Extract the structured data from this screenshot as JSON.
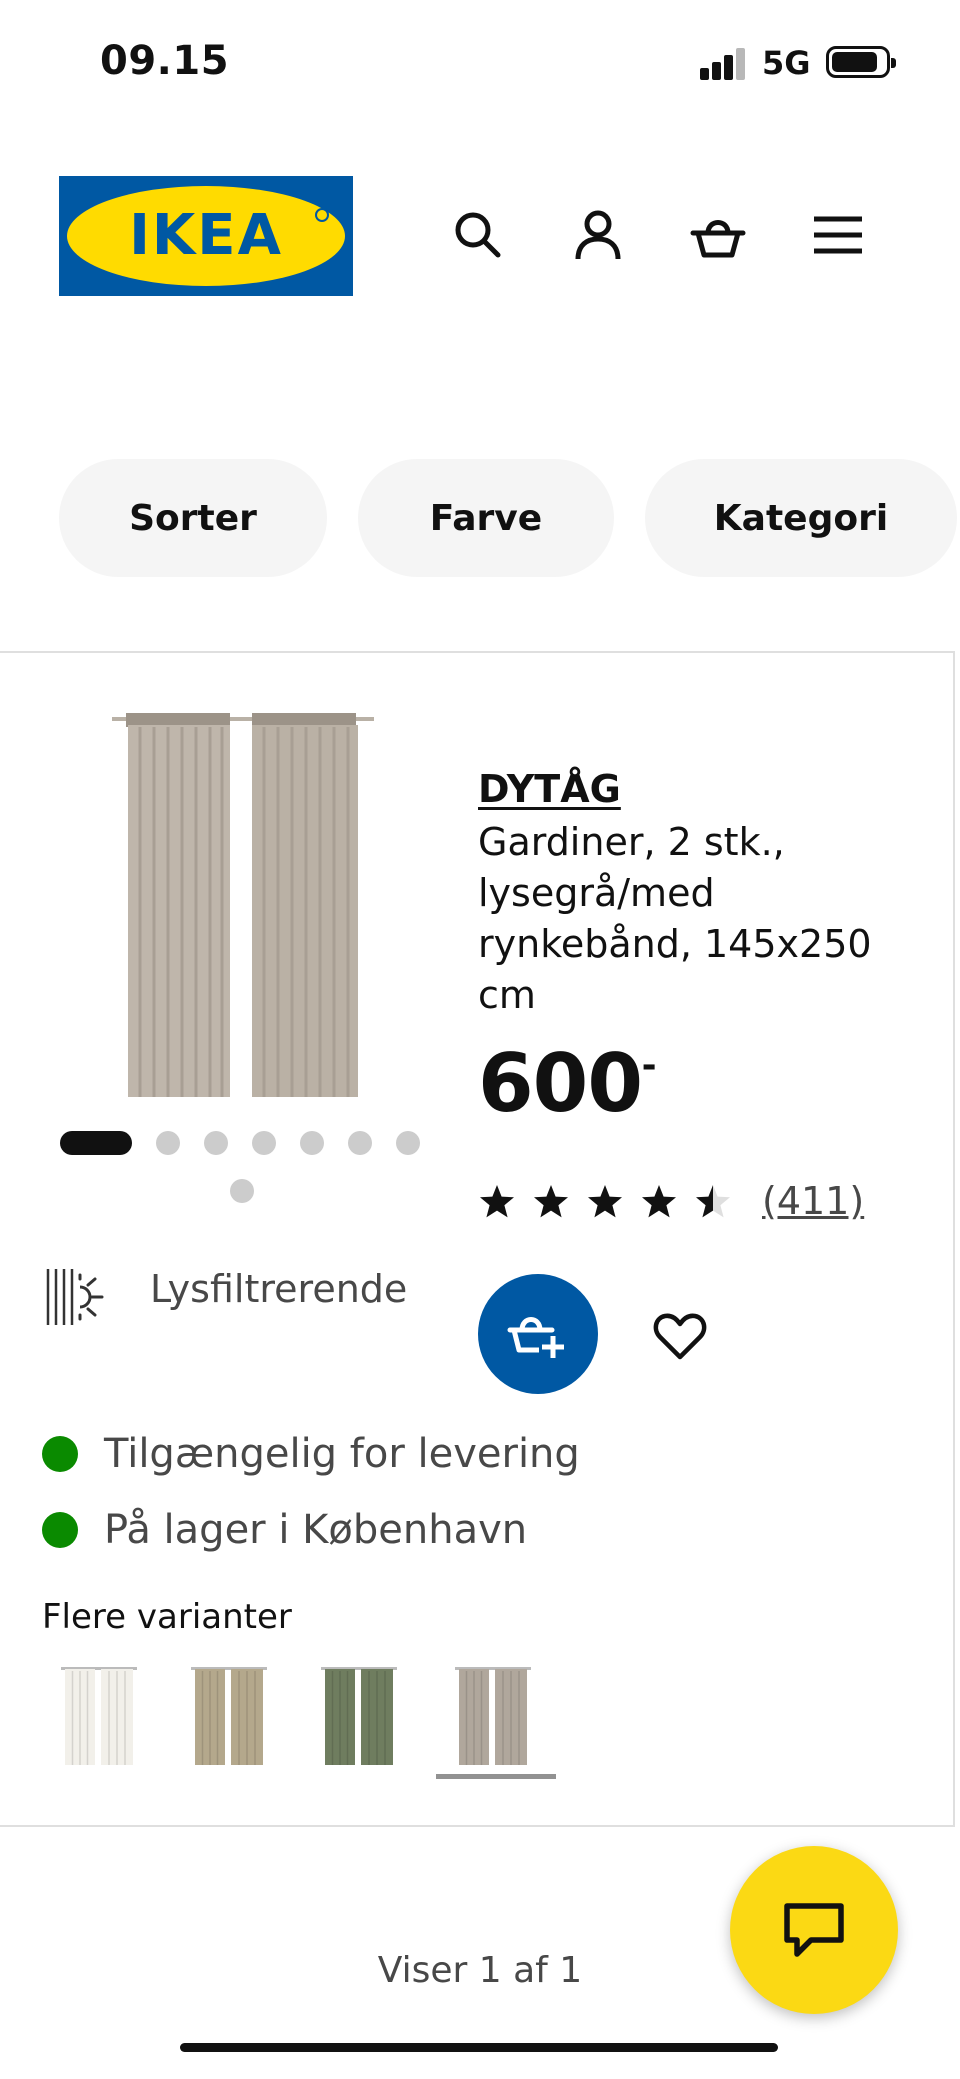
{
  "status_bar": {
    "time": "09.15",
    "network": "5G",
    "icons": [
      "signal-icon",
      "battery-icon"
    ]
  },
  "header": {
    "logo_text": "IKEA",
    "brand_colors": {
      "blue": "#0058a3",
      "yellow": "#ffdb00"
    },
    "icons": [
      "search-icon",
      "account-icon",
      "cart-icon",
      "menu-icon"
    ]
  },
  "filters": [
    {
      "label": "Sorter"
    },
    {
      "label": "Farve"
    },
    {
      "label": "Kategori"
    }
  ],
  "product": {
    "name": "DYTÅG",
    "description": "Gardiner, 2 stk., lysegrå/med rynkebånd, 145x250 cm",
    "price": "600",
    "price_suffix": ".-",
    "rating": 4.5,
    "rating_max": 5,
    "review_count": "(411)",
    "feature_label": "Lysfiltrerende",
    "feature_icon": "light-filtering-icon",
    "carousel": {
      "total": 8,
      "active_index": 0
    },
    "availability": [
      {
        "text": "Tilgængelig for levering",
        "status_color": "#0a8a00"
      },
      {
        "text": "På lager i København",
        "status_color": "#0a8a00"
      }
    ],
    "variants_title": "Flere varianter",
    "variants": [
      {
        "color": "#f2f0ea",
        "selected": false
      },
      {
        "color": "#b4a88c",
        "selected": false
      },
      {
        "color": "#6f7d5f",
        "selected": false
      },
      {
        "color": "#b0a79c",
        "selected": true
      }
    ],
    "accent_color": "#0058a3"
  },
  "pagination": {
    "text": "Viser 1 af 1"
  },
  "chat": {
    "icon": "chat-icon",
    "color": "#fbd914"
  }
}
